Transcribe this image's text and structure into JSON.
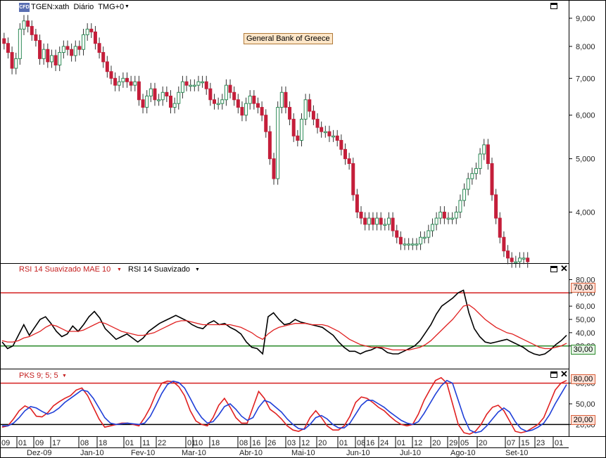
{
  "header": {
    "logo_text": "CFD",
    "symbol": "TGEN:xath",
    "period": "Diário",
    "timezone": "TMG+0",
    "instrument_label": "General Bank of Greece"
  },
  "rsi_panel": {
    "label_ma": "RSI 14 Suavizado MAE 10",
    "label_rsi": "RSI 14 Suavizado",
    "level_high": "70,00",
    "level_low": "30,00"
  },
  "pks_panel": {
    "label": "PKS 9; 5; 5",
    "level_high": "80,00",
    "level_low": "20,00"
  },
  "colors": {
    "up": "#2e8b57",
    "down": "#c41e3a",
    "rsi": "#000000",
    "rsi_ma": "#e02020",
    "pks_fast": "#e02020",
    "pks_slow": "#1f3fd8",
    "level_red": "#d42020",
    "level_green": "#2a8a2a"
  },
  "chart_data": [
    {
      "type": "candlestick",
      "title": "General Bank of Greece",
      "y_scale": "log",
      "y_ticks": [
        "9,000",
        "8,000",
        "7,000",
        "6,000",
        "5,000",
        "4,000"
      ],
      "y_tick_values": [
        9,
        8,
        7,
        6,
        5,
        4
      ],
      "ylim": [
        3.25,
        9.6
      ],
      "series_close": [
        8.1,
        7.8,
        7.3,
        7.6,
        8.6,
        8.9,
        8.7,
        8.4,
        8.2,
        7.6,
        7.9,
        7.5,
        7.7,
        7.4,
        7.8,
        8.0,
        7.9,
        7.7,
        8.0,
        7.9,
        8.4,
        8.6,
        8.5,
        8.1,
        7.8,
        7.5,
        7.2,
        7.0,
        6.8,
        6.9,
        7.0,
        6.9,
        6.8,
        6.9,
        6.4,
        6.2,
        6.5,
        6.7,
        6.4,
        6.4,
        6.6,
        6.5,
        6.2,
        6.3,
        6.6,
        6.9,
        6.8,
        6.8,
        6.8,
        6.9,
        6.9,
        6.7,
        6.4,
        6.3,
        6.3,
        6.4,
        6.8,
        6.6,
        6.4,
        6.2,
        6.0,
        6.3,
        6.5,
        6.3,
        6.2,
        6.0,
        5.6,
        5.0,
        4.6,
        6.2,
        6.6,
        6.2,
        5.9,
        5.5,
        5.4,
        5.9,
        6.4,
        6.1,
        5.9,
        5.7,
        5.6,
        5.6,
        5.5,
        5.5,
        5.4,
        5.2,
        5.0,
        4.9,
        4.3,
        4.0,
        3.9,
        3.8,
        3.9,
        3.8,
        3.9,
        3.8,
        3.8,
        3.9,
        3.7,
        3.6,
        3.5,
        3.5,
        3.5,
        3.5,
        3.5,
        3.6,
        3.6,
        3.7,
        3.8,
        3.9,
        4.0,
        3.9,
        3.9,
        3.9,
        4.0,
        4.2,
        4.4,
        4.6,
        4.7,
        4.8,
        5.1,
        5.3,
        4.9,
        4.3,
        3.9,
        3.6,
        3.4,
        3.3,
        3.25,
        3.25,
        3.3,
        3.3,
        3.25
      ]
    },
    {
      "type": "line",
      "title": "RSI 14 Suavizado MAE 10",
      "y_ticks": [
        "80,00",
        "70,00",
        "60,00",
        "50,00",
        "40,00",
        "30,00"
      ],
      "y_tick_values": [
        80,
        70,
        60,
        50,
        40,
        30
      ],
      "ylim": [
        15,
        85
      ],
      "levels": [
        70,
        30
      ],
      "series": [
        {
          "name": "RSI 14 Suavizado",
          "values": [
            33,
            28,
            30,
            38,
            46,
            38,
            44,
            50,
            52,
            47,
            41,
            37,
            39,
            45,
            41,
            46,
            52,
            56,
            51,
            43,
            39,
            35,
            37,
            39,
            36,
            33,
            36,
            41,
            44,
            47,
            49,
            51,
            53,
            51,
            49,
            46,
            44,
            43,
            47,
            49,
            46,
            47,
            44,
            42,
            39,
            33,
            29,
            28,
            24,
            52,
            55,
            50,
            46,
            47,
            50,
            48,
            47,
            46,
            45,
            44,
            41,
            38,
            33,
            29,
            26,
            26,
            24,
            26,
            27,
            29,
            28,
            25,
            24,
            24,
            26,
            28,
            30,
            34,
            40,
            46,
            54,
            60,
            63,
            66,
            70,
            72,
            55,
            43,
            37,
            33,
            32,
            33,
            34,
            35,
            33,
            31,
            29,
            26,
            24,
            23,
            24,
            27,
            31,
            34,
            38
          ]
        },
        {
          "name": "RSI 14 Suavizado MAE 10",
          "values": [
            34,
            33,
            33,
            34,
            36,
            37,
            39,
            41,
            44,
            46,
            45,
            43,
            41,
            41,
            41,
            42,
            44,
            46,
            48,
            47,
            45,
            43,
            41,
            40,
            39,
            38,
            38,
            39,
            40,
            42,
            44,
            46,
            48,
            49,
            49,
            48,
            47,
            46,
            46,
            46,
            46,
            46,
            46,
            45,
            44,
            42,
            40,
            37,
            35,
            39,
            42,
            44,
            45,
            46,
            47,
            47,
            47,
            46,
            46,
            46,
            45,
            43,
            41,
            38,
            35,
            33,
            31,
            30,
            29,
            29,
            29,
            28,
            27,
            27,
            27,
            27,
            28,
            29,
            31,
            34,
            38,
            42,
            46,
            50,
            55,
            60,
            61,
            58,
            54,
            50,
            47,
            44,
            42,
            40,
            39,
            37,
            35,
            33,
            31,
            29,
            28,
            28,
            29,
            30,
            32
          ]
        }
      ]
    },
    {
      "type": "line",
      "title": "PKS 9; 5; 5",
      "y_ticks": [
        "80,00",
        "50,00",
        "20,00"
      ],
      "y_tick_values": [
        80,
        50,
        20
      ],
      "ylim": [
        5,
        95
      ],
      "levels": [
        80,
        20
      ],
      "series": [
        {
          "name": "PKS fast",
          "values": [
            16,
            18,
            28,
            40,
            47,
            43,
            32,
            31,
            37,
            47,
            53,
            58,
            62,
            70,
            73,
            62,
            45,
            28,
            16,
            18,
            20,
            22,
            22,
            20,
            18,
            30,
            45,
            65,
            80,
            83,
            82,
            75,
            62,
            40,
            25,
            20,
            18,
            30,
            48,
            58,
            45,
            30,
            22,
            22,
            45,
            68,
            58,
            42,
            36,
            28,
            18,
            12,
            10,
            14,
            30,
            40,
            30,
            18,
            12,
            12,
            18,
            32,
            52,
            60,
            58,
            52,
            45,
            40,
            32,
            25,
            20,
            18,
            20,
            35,
            55,
            70,
            84,
            88,
            80,
            50,
            20,
            8,
            6,
            10,
            20,
            35,
            45,
            48,
            40,
            25,
            10,
            8,
            10,
            15,
            20,
            30,
            50,
            70,
            80,
            84
          ]
        },
        {
          "name": "PKS slow",
          "values": [
            18,
            18,
            22,
            30,
            40,
            46,
            44,
            39,
            35,
            38,
            44,
            52,
            58,
            64,
            70,
            68,
            58,
            44,
            30,
            22,
            20,
            21,
            22,
            21,
            20,
            22,
            32,
            48,
            65,
            78,
            83,
            81,
            73,
            58,
            42,
            30,
            22,
            24,
            34,
            46,
            50,
            42,
            32,
            26,
            30,
            45,
            55,
            52,
            45,
            38,
            28,
            20,
            14,
            13,
            20,
            30,
            33,
            28,
            20,
            15,
            15,
            22,
            35,
            48,
            55,
            55,
            50,
            45,
            38,
            32,
            26,
            22,
            20,
            24,
            36,
            50,
            64,
            76,
            84,
            80,
            55,
            30,
            12,
            8,
            10,
            18,
            28,
            38,
            44,
            38,
            24,
            14,
            10,
            12,
            16,
            22,
            34,
            50,
            64,
            78
          ]
        }
      ]
    }
  ],
  "x_axis": {
    "day_labels": [
      "09",
      "01",
      "09",
      "17",
      "08",
      "18",
      "01",
      "11",
      "22",
      "01",
      "10",
      "18",
      "08",
      "16",
      "26",
      "03",
      "12",
      "20",
      "01",
      "08",
      "16",
      "24",
      "01",
      "12",
      "20",
      "29",
      "05",
      "20",
      "07",
      "15",
      "23",
      "01"
    ],
    "month_labels": [
      "Dez-09",
      "Jan-10",
      "Fev-10",
      "Mar-10",
      "Abr-10",
      "Mai-10",
      "Jun-10",
      "Jul-10",
      "Ago-10",
      "Set-10"
    ]
  }
}
